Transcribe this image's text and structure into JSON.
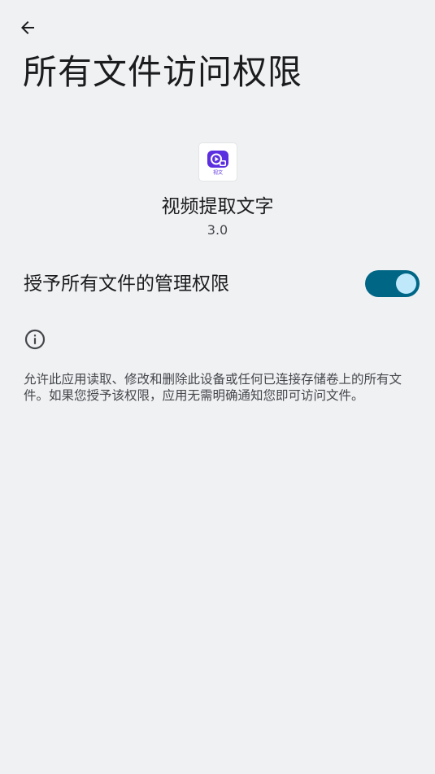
{
  "header": {
    "back_icon": "arrow-back-icon",
    "title": "所有文件访问权限"
  },
  "app": {
    "icon": "video-text-app-icon",
    "icon_badge": "视文",
    "name": "视频提取文字",
    "version": "3.0"
  },
  "permission": {
    "label": "授予所有文件的管理权限",
    "enabled": true,
    "accent_color": "#006686"
  },
  "info": {
    "icon": "info-icon",
    "description": "允许此应用读取、修改和删除此设备或任何已连接存储卷上的所有文件。如果您授予该权限，应用无需明确通知您即可访问文件。"
  }
}
